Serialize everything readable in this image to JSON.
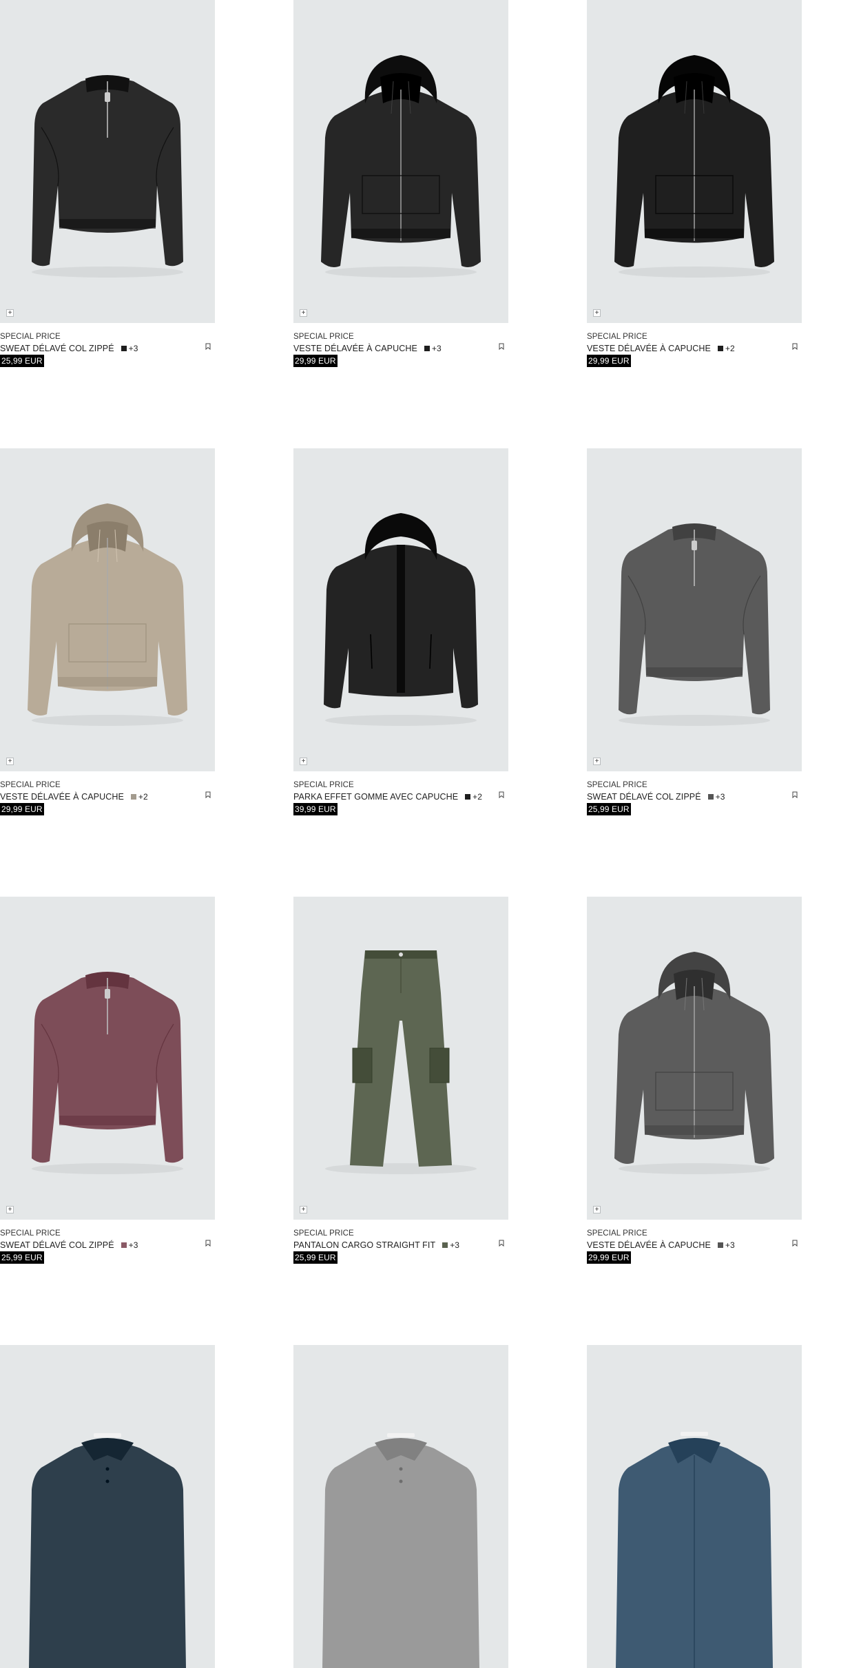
{
  "colors": {
    "image_bg": "#e4e7e8",
    "price_bg": "#000000",
    "price_text": "#ffffff"
  },
  "products": [
    {
      "tag": "SPECIAL PRICE",
      "name": "SWEAT DÉLAVÉ COL ZIPPÉ",
      "swatch": "#1e1e1e",
      "more": "+3",
      "price": "25,99 EUR",
      "garment": "quarter-zip",
      "color": "#2a2a2a"
    },
    {
      "tag": "SPECIAL PRICE",
      "name": "VESTE DÉLAVÉE À CAPUCHE",
      "swatch": "#1e1e1e",
      "more": "+3",
      "price": "29,99 EUR",
      "garment": "hoodie-jacket",
      "color": "#262626"
    },
    {
      "tag": "SPECIAL PRICE",
      "name": "VESTE DÉLAVÉE À CAPUCHE",
      "swatch": "#1e1e1e",
      "more": "+2",
      "price": "29,99 EUR",
      "garment": "hoodie-jacket",
      "color": "#1f1f1f"
    },
    {
      "tag": "SPECIAL PRICE",
      "name": "VESTE DÉLAVÉE À CAPUCHE",
      "swatch": "#a39b8e",
      "more": "+2",
      "price": "29,99 EUR",
      "garment": "hoodie-jacket",
      "color": "#b8ab98"
    },
    {
      "tag": "SPECIAL PRICE",
      "name": "PARKA EFFET GOMME AVEC CAPUCHE",
      "swatch": "#1e1e1e",
      "more": "+2",
      "price": "39,99 EUR",
      "garment": "parka",
      "color": "#232323"
    },
    {
      "tag": "SPECIAL PRICE",
      "name": "SWEAT DÉLAVÉ COL ZIPPÉ",
      "swatch": "#555555",
      "more": "+3",
      "price": "25,99 EUR",
      "garment": "quarter-zip",
      "color": "#5a5a5a"
    },
    {
      "tag": "SPECIAL PRICE",
      "name": "SWEAT DÉLAVÉ COL ZIPPÉ",
      "swatch": "#8a5a66",
      "more": "+3",
      "price": "25,99 EUR",
      "garment": "quarter-zip",
      "color": "#7d4d58"
    },
    {
      "tag": "SPECIAL PRICE",
      "name": "PANTALON CARGO STRAIGHT FIT",
      "swatch": "#5b6350",
      "more": "+3",
      "price": "25,99 EUR",
      "garment": "cargo-pants",
      "color": "#5d6652"
    },
    {
      "tag": "SPECIAL PRICE",
      "name": "VESTE DÉLAVÉE À CAPUCHE",
      "swatch": "#555555",
      "more": "+3",
      "price": "29,99 EUR",
      "garment": "hoodie-jacket",
      "color": "#5c5c5c"
    },
    {
      "garment": "polo",
      "color": "#2e3f4c"
    },
    {
      "garment": "polo",
      "color": "#9a9a9a"
    },
    {
      "garment": "denim-shirt",
      "color": "#3e5a72"
    }
  ]
}
